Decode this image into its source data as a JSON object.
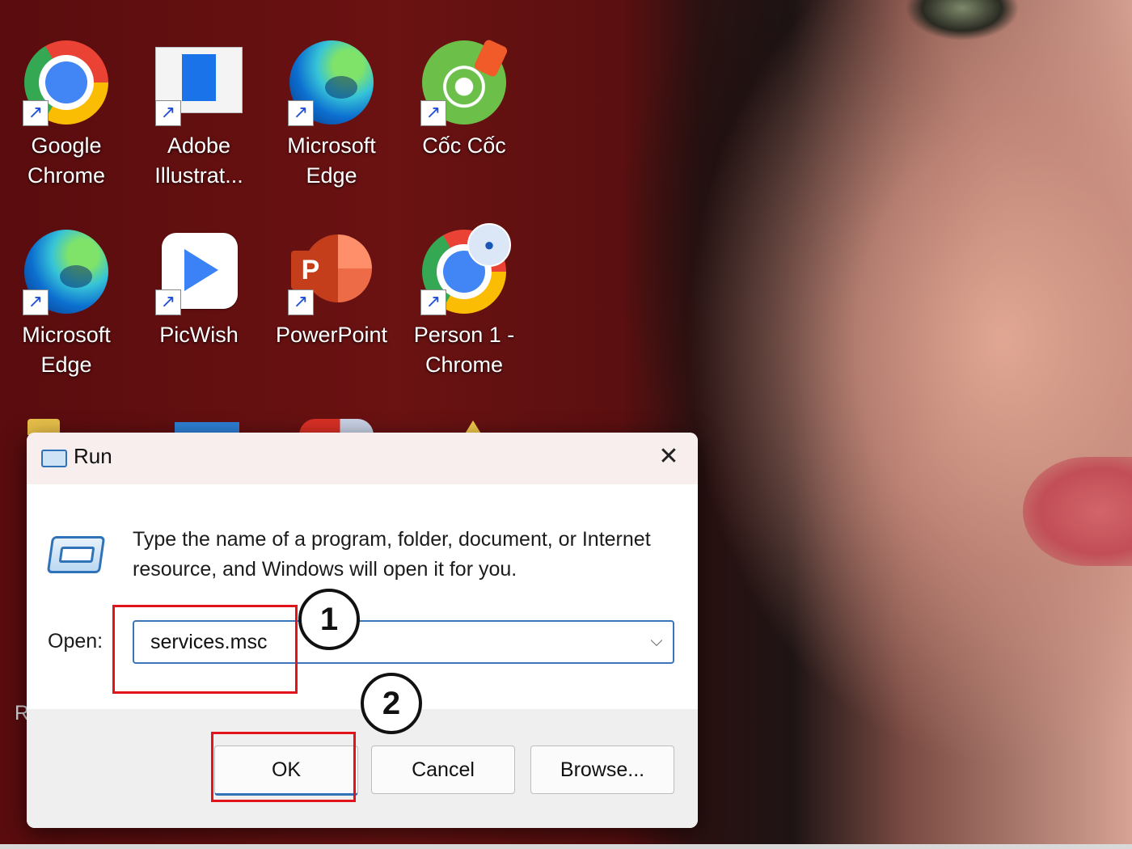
{
  "desktop": {
    "icons": [
      {
        "icon": "chrome-icon",
        "label": "Google Chrome"
      },
      {
        "icon": "adobe-illustrator-icon",
        "label": "Adobe Illustrat..."
      },
      {
        "icon": "edge-icon",
        "label": "Microsoft Edge"
      },
      {
        "icon": "coc-coc-icon",
        "label": "Cốc Cốc"
      },
      {
        "icon": "edge-icon",
        "label": "Microsoft Edge"
      },
      {
        "icon": "picwish-icon",
        "label": "PicWish"
      },
      {
        "icon": "powerpoint-icon",
        "label": "PowerPoint"
      },
      {
        "icon": "chrome-profile-icon",
        "label": "Person 1 - Chrome"
      }
    ],
    "powerpoint_letter": "P",
    "partial_label_letter": "R"
  },
  "run_dialog": {
    "title": "Run",
    "close_glyph": "✕",
    "description": "Type the name of a program, folder, document, or Internet resource, and Windows will open it for you.",
    "open_label": "Open:",
    "open_value": "services.msc",
    "dropdown_glyph": "⌵",
    "buttons": {
      "ok": "OK",
      "cancel": "Cancel",
      "browse": "Browse..."
    }
  },
  "annotations": {
    "step1": "1",
    "step2": "2",
    "highlight_color": "#e3131b"
  },
  "colors": {
    "accent": "#2f72b8",
    "desktop_bg": "#5a0c0e"
  }
}
